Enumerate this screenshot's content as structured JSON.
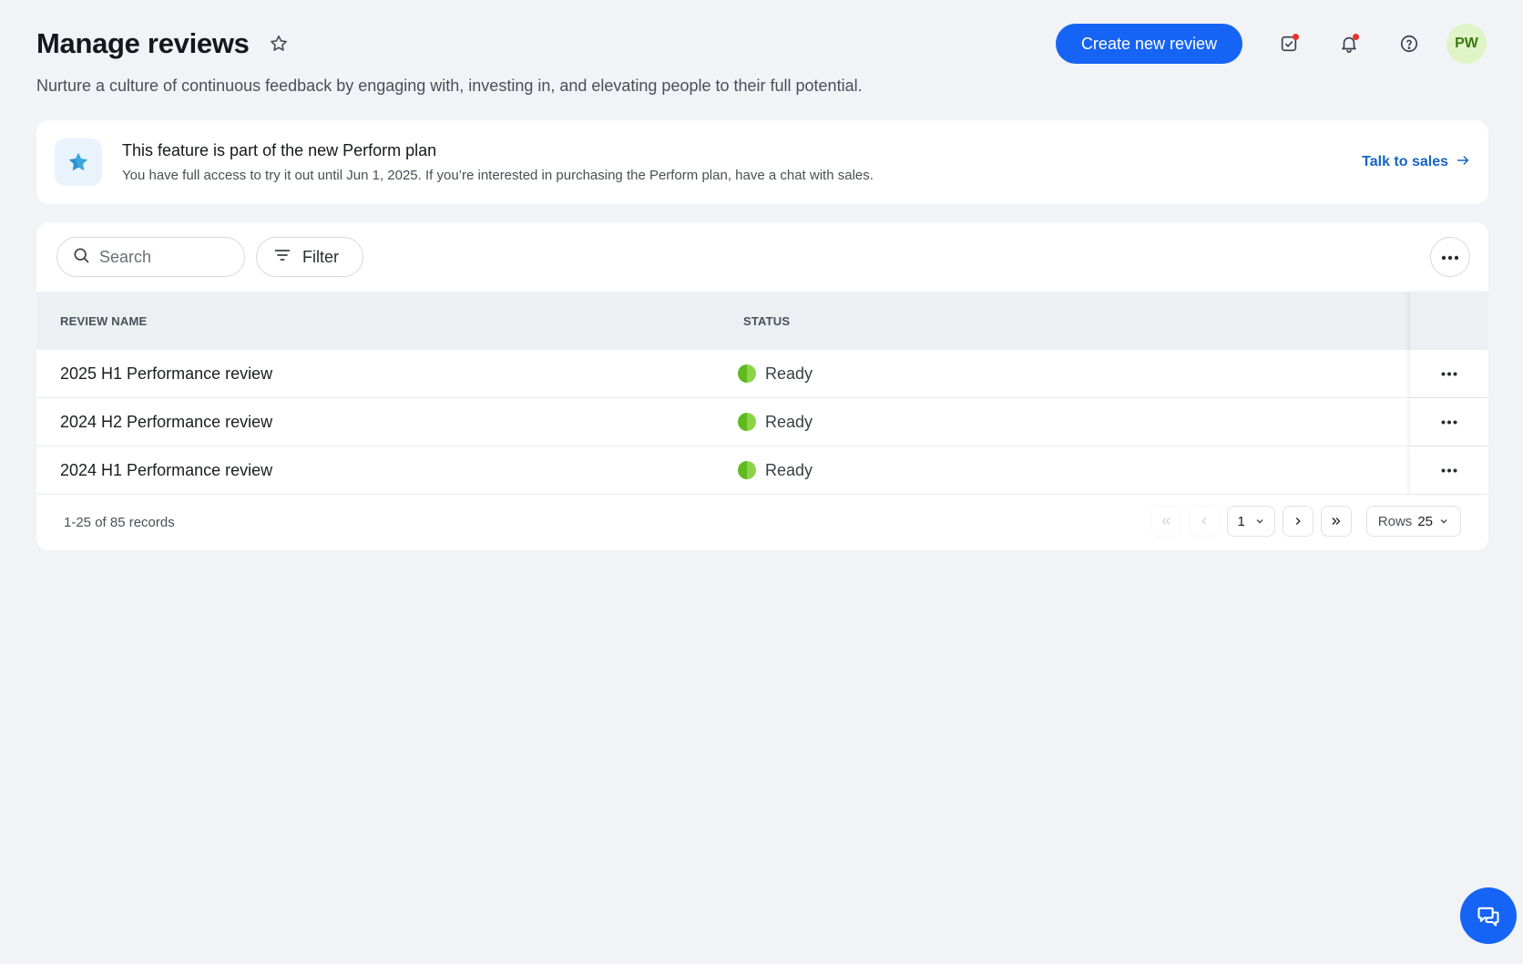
{
  "header": {
    "title": "Manage reviews",
    "subtitle": "Nurture a culture of continuous feedback by engaging with, investing in, and elevating people to their full potential.",
    "create_button": "Create new review",
    "avatar_initials": "PW"
  },
  "banner": {
    "title": "This feature is part of the new Perform plan",
    "description": "You have full access to try it out until Jun 1, 2025. If you’re interested in purchasing the Perform plan, have a chat with sales.",
    "link_label": "Talk to sales"
  },
  "toolbar": {
    "search_placeholder": "Search",
    "filter_label": "Filter"
  },
  "table": {
    "columns": {
      "name": "REVIEW NAME",
      "status": "STATUS"
    },
    "rows": [
      {
        "name": "2025 H1 Performance review",
        "status": "Ready"
      },
      {
        "name": "2024 H2 Performance review",
        "status": "Ready"
      },
      {
        "name": "2024 H1 Performance review",
        "status": "Ready"
      }
    ]
  },
  "pagination": {
    "records": "1-25 of 85 records",
    "page": "1",
    "rows_label": "Rows",
    "rows_value": "25"
  },
  "colors": {
    "primary": "#1664f5",
    "ready": "#5fb91f",
    "notification_dot": "#e8312f"
  }
}
